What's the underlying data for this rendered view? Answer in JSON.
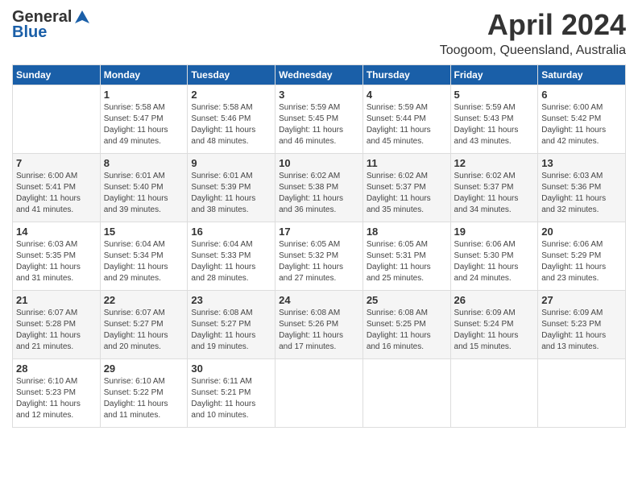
{
  "header": {
    "logo_general": "General",
    "logo_blue": "Blue",
    "month": "April 2024",
    "location": "Toogoom, Queensland, Australia"
  },
  "weekdays": [
    "Sunday",
    "Monday",
    "Tuesday",
    "Wednesday",
    "Thursday",
    "Friday",
    "Saturday"
  ],
  "weeks": [
    [
      {
        "day": null,
        "info": null
      },
      {
        "day": "1",
        "info": "Sunrise: 5:58 AM\nSunset: 5:47 PM\nDaylight: 11 hours\nand 49 minutes."
      },
      {
        "day": "2",
        "info": "Sunrise: 5:58 AM\nSunset: 5:46 PM\nDaylight: 11 hours\nand 48 minutes."
      },
      {
        "day": "3",
        "info": "Sunrise: 5:59 AM\nSunset: 5:45 PM\nDaylight: 11 hours\nand 46 minutes."
      },
      {
        "day": "4",
        "info": "Sunrise: 5:59 AM\nSunset: 5:44 PM\nDaylight: 11 hours\nand 45 minutes."
      },
      {
        "day": "5",
        "info": "Sunrise: 5:59 AM\nSunset: 5:43 PM\nDaylight: 11 hours\nand 43 minutes."
      },
      {
        "day": "6",
        "info": "Sunrise: 6:00 AM\nSunset: 5:42 PM\nDaylight: 11 hours\nand 42 minutes."
      }
    ],
    [
      {
        "day": "7",
        "info": "Sunrise: 6:00 AM\nSunset: 5:41 PM\nDaylight: 11 hours\nand 41 minutes."
      },
      {
        "day": "8",
        "info": "Sunrise: 6:01 AM\nSunset: 5:40 PM\nDaylight: 11 hours\nand 39 minutes."
      },
      {
        "day": "9",
        "info": "Sunrise: 6:01 AM\nSunset: 5:39 PM\nDaylight: 11 hours\nand 38 minutes."
      },
      {
        "day": "10",
        "info": "Sunrise: 6:02 AM\nSunset: 5:38 PM\nDaylight: 11 hours\nand 36 minutes."
      },
      {
        "day": "11",
        "info": "Sunrise: 6:02 AM\nSunset: 5:37 PM\nDaylight: 11 hours\nand 35 minutes."
      },
      {
        "day": "12",
        "info": "Sunrise: 6:02 AM\nSunset: 5:37 PM\nDaylight: 11 hours\nand 34 minutes."
      },
      {
        "day": "13",
        "info": "Sunrise: 6:03 AM\nSunset: 5:36 PM\nDaylight: 11 hours\nand 32 minutes."
      }
    ],
    [
      {
        "day": "14",
        "info": "Sunrise: 6:03 AM\nSunset: 5:35 PM\nDaylight: 11 hours\nand 31 minutes."
      },
      {
        "day": "15",
        "info": "Sunrise: 6:04 AM\nSunset: 5:34 PM\nDaylight: 11 hours\nand 29 minutes."
      },
      {
        "day": "16",
        "info": "Sunrise: 6:04 AM\nSunset: 5:33 PM\nDaylight: 11 hours\nand 28 minutes."
      },
      {
        "day": "17",
        "info": "Sunrise: 6:05 AM\nSunset: 5:32 PM\nDaylight: 11 hours\nand 27 minutes."
      },
      {
        "day": "18",
        "info": "Sunrise: 6:05 AM\nSunset: 5:31 PM\nDaylight: 11 hours\nand 25 minutes."
      },
      {
        "day": "19",
        "info": "Sunrise: 6:06 AM\nSunset: 5:30 PM\nDaylight: 11 hours\nand 24 minutes."
      },
      {
        "day": "20",
        "info": "Sunrise: 6:06 AM\nSunset: 5:29 PM\nDaylight: 11 hours\nand 23 minutes."
      }
    ],
    [
      {
        "day": "21",
        "info": "Sunrise: 6:07 AM\nSunset: 5:28 PM\nDaylight: 11 hours\nand 21 minutes."
      },
      {
        "day": "22",
        "info": "Sunrise: 6:07 AM\nSunset: 5:27 PM\nDaylight: 11 hours\nand 20 minutes."
      },
      {
        "day": "23",
        "info": "Sunrise: 6:08 AM\nSunset: 5:27 PM\nDaylight: 11 hours\nand 19 minutes."
      },
      {
        "day": "24",
        "info": "Sunrise: 6:08 AM\nSunset: 5:26 PM\nDaylight: 11 hours\nand 17 minutes."
      },
      {
        "day": "25",
        "info": "Sunrise: 6:08 AM\nSunset: 5:25 PM\nDaylight: 11 hours\nand 16 minutes."
      },
      {
        "day": "26",
        "info": "Sunrise: 6:09 AM\nSunset: 5:24 PM\nDaylight: 11 hours\nand 15 minutes."
      },
      {
        "day": "27",
        "info": "Sunrise: 6:09 AM\nSunset: 5:23 PM\nDaylight: 11 hours\nand 13 minutes."
      }
    ],
    [
      {
        "day": "28",
        "info": "Sunrise: 6:10 AM\nSunset: 5:23 PM\nDaylight: 11 hours\nand 12 minutes."
      },
      {
        "day": "29",
        "info": "Sunrise: 6:10 AM\nSunset: 5:22 PM\nDaylight: 11 hours\nand 11 minutes."
      },
      {
        "day": "30",
        "info": "Sunrise: 6:11 AM\nSunset: 5:21 PM\nDaylight: 11 hours\nand 10 minutes."
      },
      {
        "day": null,
        "info": null
      },
      {
        "day": null,
        "info": null
      },
      {
        "day": null,
        "info": null
      },
      {
        "day": null,
        "info": null
      }
    ]
  ]
}
